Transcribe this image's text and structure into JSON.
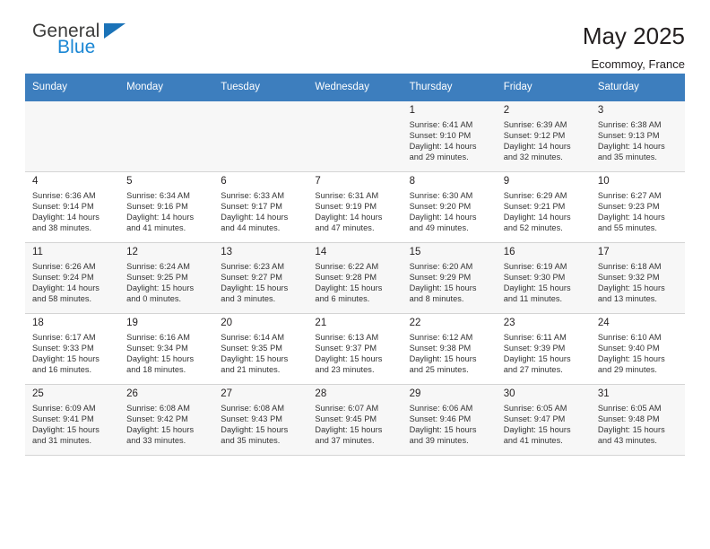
{
  "brand": {
    "name_top": "General",
    "name_bottom": "Blue",
    "triangle_color": "#1b73b8",
    "bottom_color": "#1b87d4"
  },
  "header": {
    "title": "May 2025",
    "location": "Ecommoy, France"
  },
  "theme": {
    "header_bg": "#3d7ebe",
    "header_text": "#ffffff",
    "alt_row_bg": "#f7f7f7",
    "text": "#231f20"
  },
  "weekday_headers": [
    "Sunday",
    "Monday",
    "Tuesday",
    "Wednesday",
    "Thursday",
    "Friday",
    "Saturday"
  ],
  "labels": {
    "sunrise": "Sunrise:",
    "sunset": "Sunset:",
    "daylight": "Daylight:"
  },
  "weeks": [
    [
      {
        "day": ""
      },
      {
        "day": ""
      },
      {
        "day": ""
      },
      {
        "day": ""
      },
      {
        "day": "1",
        "sunrise": "Sunrise: 6:41 AM",
        "sunset": "Sunset: 9:10 PM",
        "daylight_1": "Daylight: 14 hours",
        "daylight_2": "and 29 minutes."
      },
      {
        "day": "2",
        "sunrise": "Sunrise: 6:39 AM",
        "sunset": "Sunset: 9:12 PM",
        "daylight_1": "Daylight: 14 hours",
        "daylight_2": "and 32 minutes."
      },
      {
        "day": "3",
        "sunrise": "Sunrise: 6:38 AM",
        "sunset": "Sunset: 9:13 PM",
        "daylight_1": "Daylight: 14 hours",
        "daylight_2": "and 35 minutes."
      }
    ],
    [
      {
        "day": "4",
        "sunrise": "Sunrise: 6:36 AM",
        "sunset": "Sunset: 9:14 PM",
        "daylight_1": "Daylight: 14 hours",
        "daylight_2": "and 38 minutes."
      },
      {
        "day": "5",
        "sunrise": "Sunrise: 6:34 AM",
        "sunset": "Sunset: 9:16 PM",
        "daylight_1": "Daylight: 14 hours",
        "daylight_2": "and 41 minutes."
      },
      {
        "day": "6",
        "sunrise": "Sunrise: 6:33 AM",
        "sunset": "Sunset: 9:17 PM",
        "daylight_1": "Daylight: 14 hours",
        "daylight_2": "and 44 minutes."
      },
      {
        "day": "7",
        "sunrise": "Sunrise: 6:31 AM",
        "sunset": "Sunset: 9:19 PM",
        "daylight_1": "Daylight: 14 hours",
        "daylight_2": "and 47 minutes."
      },
      {
        "day": "8",
        "sunrise": "Sunrise: 6:30 AM",
        "sunset": "Sunset: 9:20 PM",
        "daylight_1": "Daylight: 14 hours",
        "daylight_2": "and 49 minutes."
      },
      {
        "day": "9",
        "sunrise": "Sunrise: 6:29 AM",
        "sunset": "Sunset: 9:21 PM",
        "daylight_1": "Daylight: 14 hours",
        "daylight_2": "and 52 minutes."
      },
      {
        "day": "10",
        "sunrise": "Sunrise: 6:27 AM",
        "sunset": "Sunset: 9:23 PM",
        "daylight_1": "Daylight: 14 hours",
        "daylight_2": "and 55 minutes."
      }
    ],
    [
      {
        "day": "11",
        "sunrise": "Sunrise: 6:26 AM",
        "sunset": "Sunset: 9:24 PM",
        "daylight_1": "Daylight: 14 hours",
        "daylight_2": "and 58 minutes."
      },
      {
        "day": "12",
        "sunrise": "Sunrise: 6:24 AM",
        "sunset": "Sunset: 9:25 PM",
        "daylight_1": "Daylight: 15 hours",
        "daylight_2": "and 0 minutes."
      },
      {
        "day": "13",
        "sunrise": "Sunrise: 6:23 AM",
        "sunset": "Sunset: 9:27 PM",
        "daylight_1": "Daylight: 15 hours",
        "daylight_2": "and 3 minutes."
      },
      {
        "day": "14",
        "sunrise": "Sunrise: 6:22 AM",
        "sunset": "Sunset: 9:28 PM",
        "daylight_1": "Daylight: 15 hours",
        "daylight_2": "and 6 minutes."
      },
      {
        "day": "15",
        "sunrise": "Sunrise: 6:20 AM",
        "sunset": "Sunset: 9:29 PM",
        "daylight_1": "Daylight: 15 hours",
        "daylight_2": "and 8 minutes."
      },
      {
        "day": "16",
        "sunrise": "Sunrise: 6:19 AM",
        "sunset": "Sunset: 9:30 PM",
        "daylight_1": "Daylight: 15 hours",
        "daylight_2": "and 11 minutes."
      },
      {
        "day": "17",
        "sunrise": "Sunrise: 6:18 AM",
        "sunset": "Sunset: 9:32 PM",
        "daylight_1": "Daylight: 15 hours",
        "daylight_2": "and 13 minutes."
      }
    ],
    [
      {
        "day": "18",
        "sunrise": "Sunrise: 6:17 AM",
        "sunset": "Sunset: 9:33 PM",
        "daylight_1": "Daylight: 15 hours",
        "daylight_2": "and 16 minutes."
      },
      {
        "day": "19",
        "sunrise": "Sunrise: 6:16 AM",
        "sunset": "Sunset: 9:34 PM",
        "daylight_1": "Daylight: 15 hours",
        "daylight_2": "and 18 minutes."
      },
      {
        "day": "20",
        "sunrise": "Sunrise: 6:14 AM",
        "sunset": "Sunset: 9:35 PM",
        "daylight_1": "Daylight: 15 hours",
        "daylight_2": "and 21 minutes."
      },
      {
        "day": "21",
        "sunrise": "Sunrise: 6:13 AM",
        "sunset": "Sunset: 9:37 PM",
        "daylight_1": "Daylight: 15 hours",
        "daylight_2": "and 23 minutes."
      },
      {
        "day": "22",
        "sunrise": "Sunrise: 6:12 AM",
        "sunset": "Sunset: 9:38 PM",
        "daylight_1": "Daylight: 15 hours",
        "daylight_2": "and 25 minutes."
      },
      {
        "day": "23",
        "sunrise": "Sunrise: 6:11 AM",
        "sunset": "Sunset: 9:39 PM",
        "daylight_1": "Daylight: 15 hours",
        "daylight_2": "and 27 minutes."
      },
      {
        "day": "24",
        "sunrise": "Sunrise: 6:10 AM",
        "sunset": "Sunset: 9:40 PM",
        "daylight_1": "Daylight: 15 hours",
        "daylight_2": "and 29 minutes."
      }
    ],
    [
      {
        "day": "25",
        "sunrise": "Sunrise: 6:09 AM",
        "sunset": "Sunset: 9:41 PM",
        "daylight_1": "Daylight: 15 hours",
        "daylight_2": "and 31 minutes."
      },
      {
        "day": "26",
        "sunrise": "Sunrise: 6:08 AM",
        "sunset": "Sunset: 9:42 PM",
        "daylight_1": "Daylight: 15 hours",
        "daylight_2": "and 33 minutes."
      },
      {
        "day": "27",
        "sunrise": "Sunrise: 6:08 AM",
        "sunset": "Sunset: 9:43 PM",
        "daylight_1": "Daylight: 15 hours",
        "daylight_2": "and 35 minutes."
      },
      {
        "day": "28",
        "sunrise": "Sunrise: 6:07 AM",
        "sunset": "Sunset: 9:45 PM",
        "daylight_1": "Daylight: 15 hours",
        "daylight_2": "and 37 minutes."
      },
      {
        "day": "29",
        "sunrise": "Sunrise: 6:06 AM",
        "sunset": "Sunset: 9:46 PM",
        "daylight_1": "Daylight: 15 hours",
        "daylight_2": "and 39 minutes."
      },
      {
        "day": "30",
        "sunrise": "Sunrise: 6:05 AM",
        "sunset": "Sunset: 9:47 PM",
        "daylight_1": "Daylight: 15 hours",
        "daylight_2": "and 41 minutes."
      },
      {
        "day": "31",
        "sunrise": "Sunrise: 6:05 AM",
        "sunset": "Sunset: 9:48 PM",
        "daylight_1": "Daylight: 15 hours",
        "daylight_2": "and 43 minutes."
      }
    ]
  ]
}
